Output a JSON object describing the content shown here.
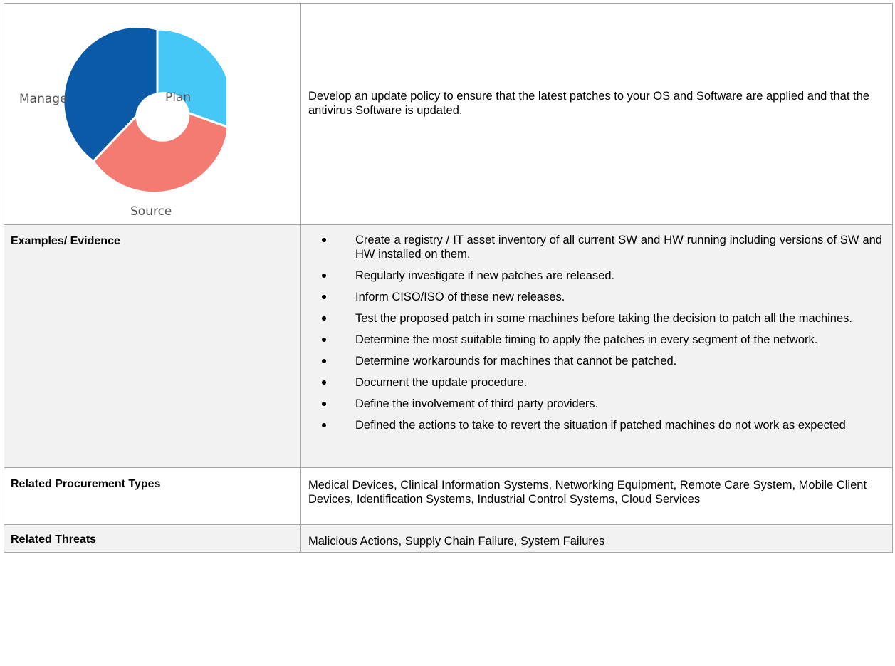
{
  "policy_graphic": {
    "segments": [
      {
        "label": "Plan",
        "color": "#45c8f5"
      },
      {
        "label": "Source",
        "color": "#f47b72"
      },
      {
        "label": "Manage",
        "color": "#0a5aa8"
      }
    ]
  },
  "description": "Develop an update policy to ensure that the latest patches to your OS and Software are applied and that the antivirus Software is updated.",
  "examples": {
    "label": "Examples/ Evidence",
    "items": [
      "Create a registry / IT asset inventory of all current SW and HW running including versions of SW and HW installed on them.",
      "Regularly investigate if new patches are released.",
      "Inform CISO/ISO of these new releases.",
      "Test the proposed patch in some machines before taking the decision to patch all the machines.",
      "Determine the most suitable timing to apply the patches in every segment of the network.",
      "Determine workarounds for machines that cannot be patched.",
      "Document the update procedure.",
      "Define the involvement of third party providers.",
      "Defined the actions to take to revert the situation if patched machines do not work as expected"
    ]
  },
  "procurement": {
    "label": "Related Procurement Types",
    "value": "Medical Devices, Clinical Information Systems, Networking Equipment, Remote Care System, Mobile Client Devices, Identification Systems, Industrial Control Systems, Cloud Services"
  },
  "threats": {
    "label": "Related Threats",
    "value": "Malicious Actions, Supply Chain Failure, System Failures"
  }
}
